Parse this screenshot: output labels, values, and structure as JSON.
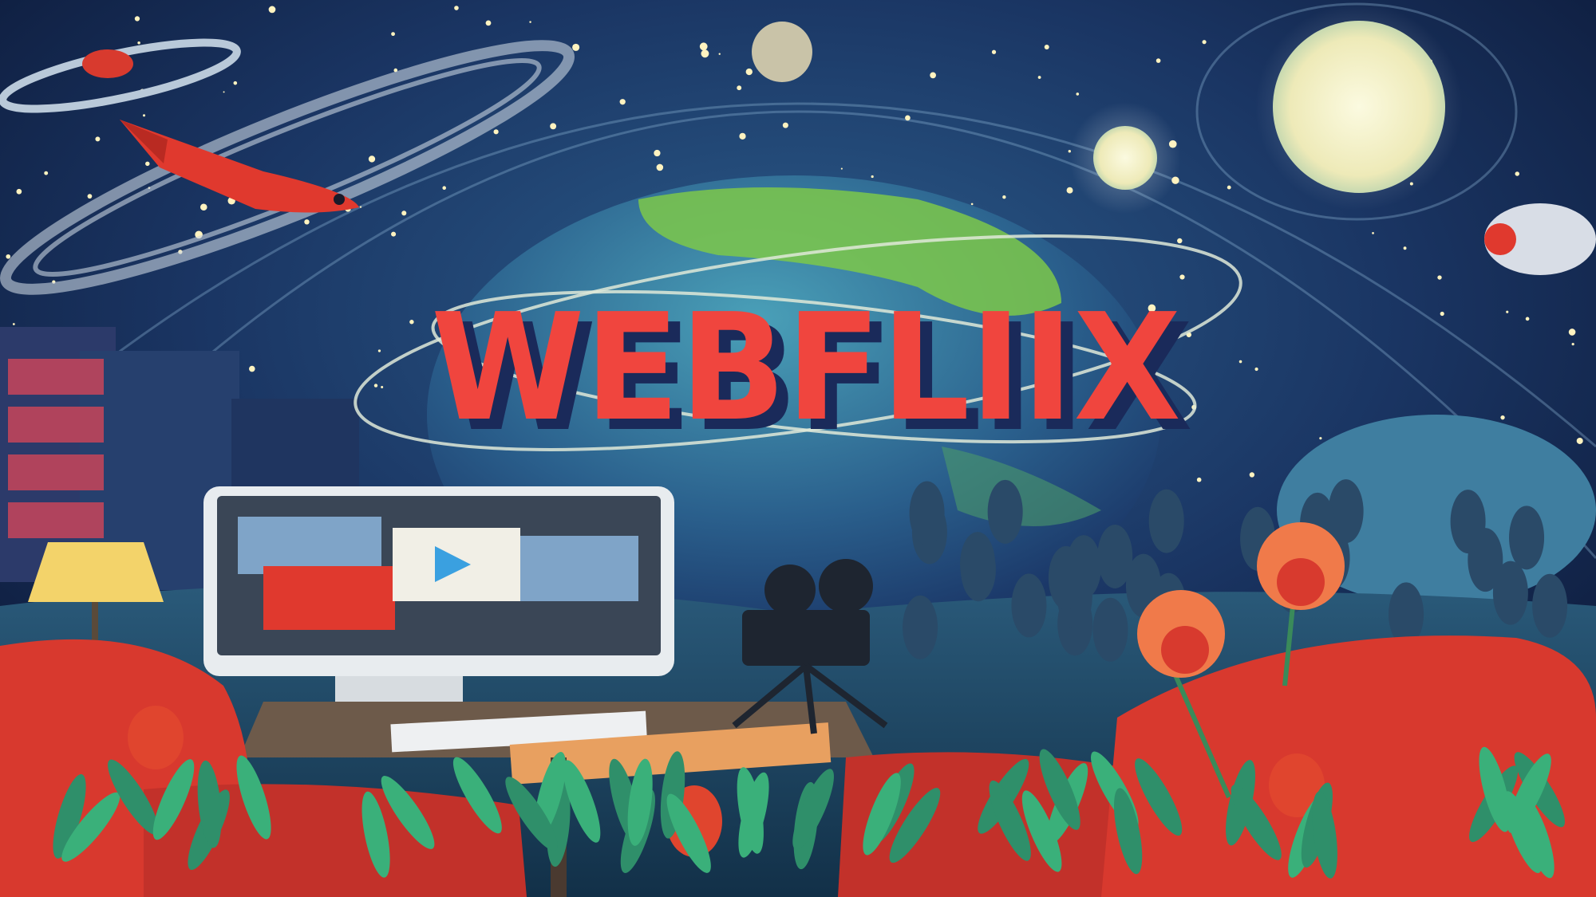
{
  "image": {
    "logo_text": "WEBFLIIX",
    "colors": {
      "sky_top": "#0b1633",
      "sky_mid": "#1d3f6e",
      "globe": "#2f6f9a",
      "land": "#7cc84a",
      "title_red": "#f0453e",
      "title_shadow": "#1a2a5a",
      "chair_red": "#d8392e",
      "moon": "#f4f3d0",
      "grass": "#2f8f6a"
    }
  }
}
